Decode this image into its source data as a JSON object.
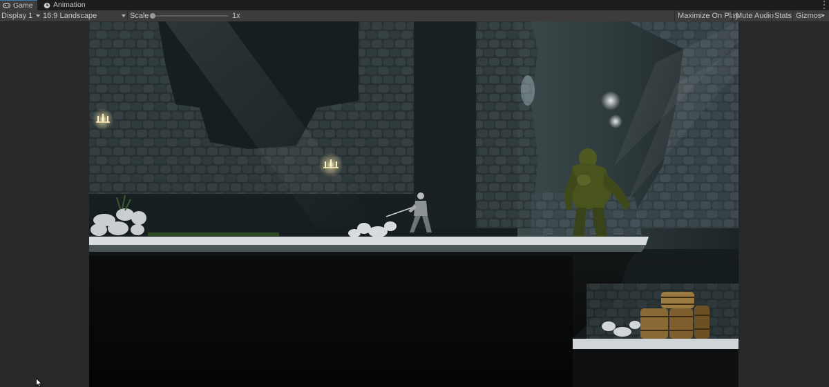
{
  "tabs": [
    {
      "label": "Game",
      "icon": "gamepad-icon",
      "active": true
    },
    {
      "label": "Animation",
      "icon": "clock-icon",
      "active": false
    }
  ],
  "toolbar": {
    "display": "Display 1",
    "aspect": "16:9 Landscape",
    "scale_label": "Scale",
    "scale_value": "1x",
    "maximize": "Maximize On Play",
    "mute": "Mute Audio",
    "stats": "Stats",
    "gizmos": "Gizmos"
  },
  "colors": {
    "tab_accent": "#3a79bb",
    "panel_bg": "#282828",
    "toolbar_bg": "#3c3c3c"
  },
  "game": {
    "scene": "dark cave level with stone walls, a player character holding a sword, a green ogre enemy, chandeliers, stacked wooden barrels",
    "icons": [
      "chandelier-icon",
      "player-icon",
      "ogre-icon",
      "barrel-icon"
    ]
  }
}
